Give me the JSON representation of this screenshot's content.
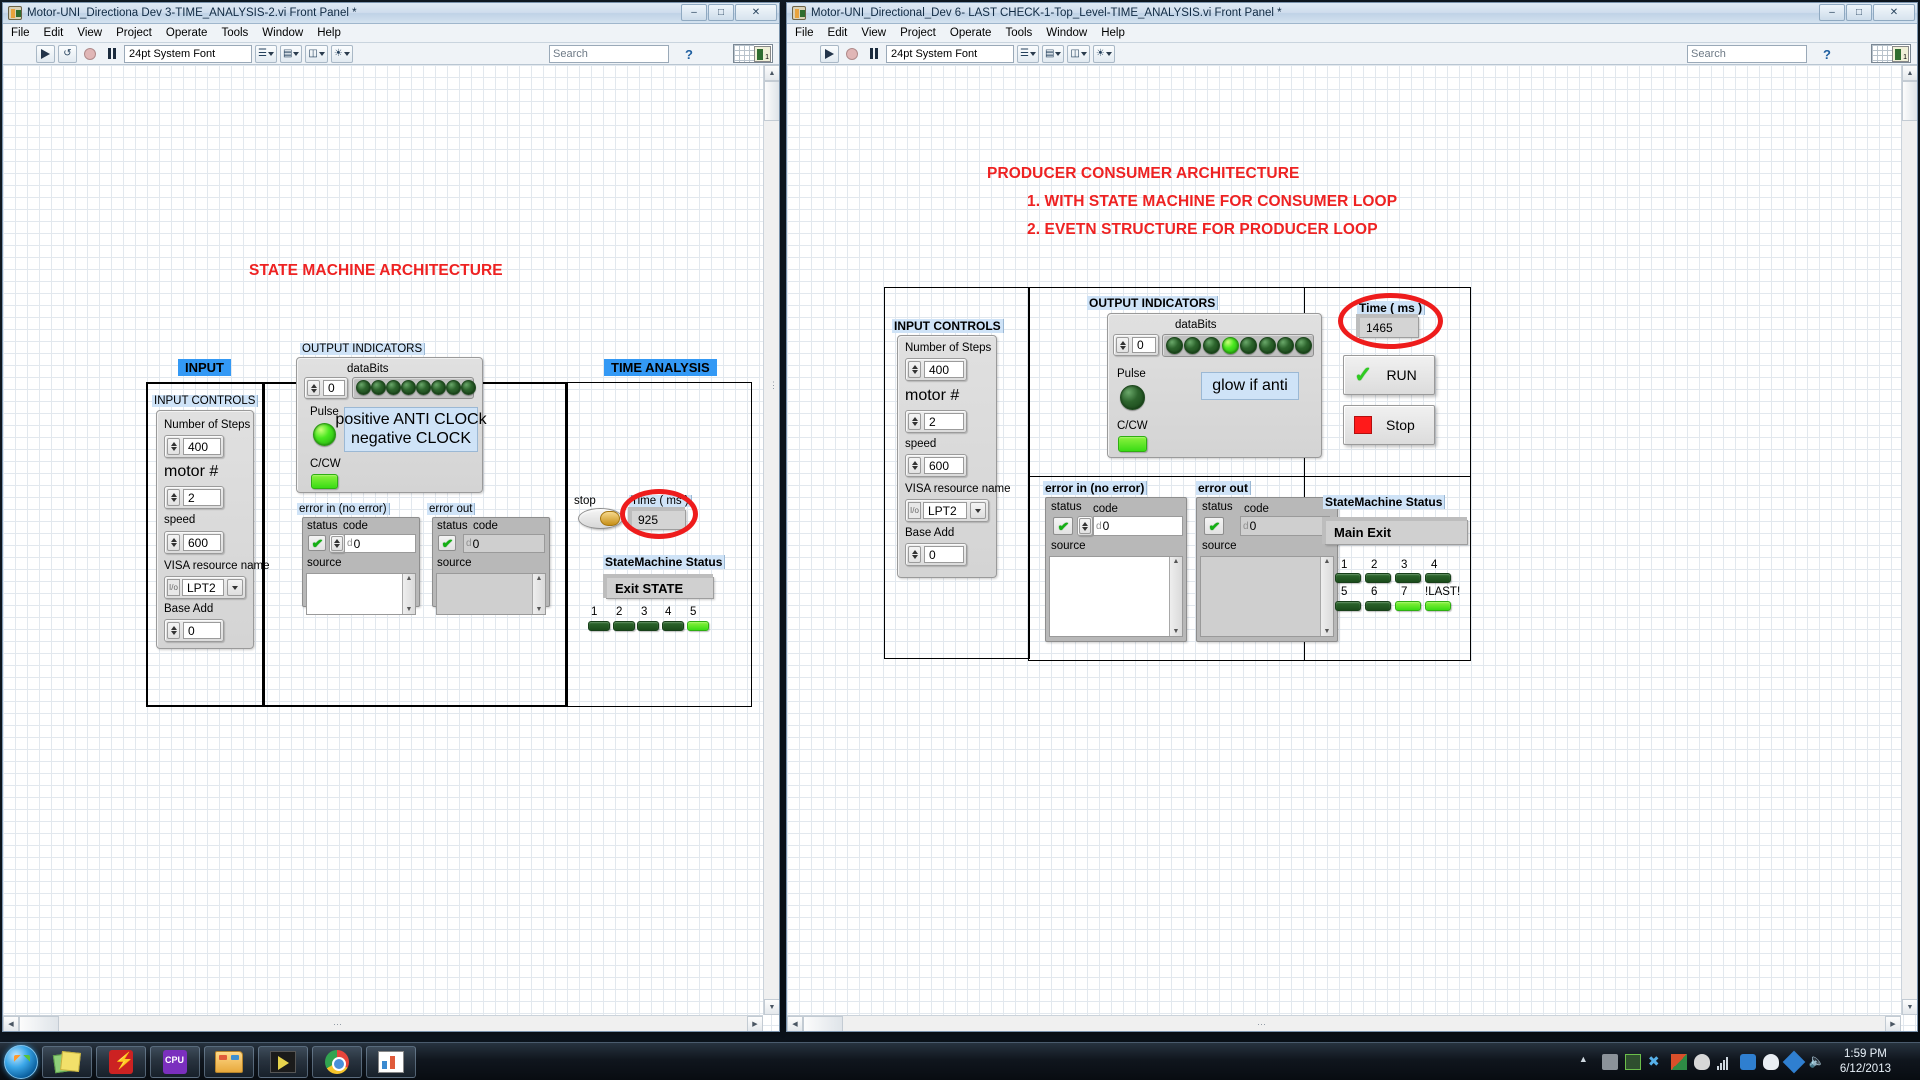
{
  "desktop": {
    "taskbar": {
      "start_label": "Start",
      "items": [
        {
          "name": "sticky-notes",
          "icon": "sticky-notes-icon"
        },
        {
          "name": "security-app",
          "icon": "shield-lightning-icon"
        },
        {
          "name": "cpu-monitor",
          "icon": "cpu-icon"
        },
        {
          "name": "windows-explorer",
          "icon": "folder-icon"
        },
        {
          "name": "labview",
          "icon": "labview-icon"
        },
        {
          "name": "google-chrome",
          "icon": "chrome-icon"
        },
        {
          "name": "labview-project",
          "icon": "labview-vi-icon"
        }
      ],
      "tray_icons": [
        "show-hidden-icons-arrow",
        "usb-safely-remove-icon",
        "network-activity-icon",
        "xmarks-icon",
        "winrar-icon",
        "volume-mixer-icon",
        "signal-bars-icon",
        "teamviewer-icon",
        "skydrive-icon",
        "dropbox-icon",
        "speaker-icon"
      ],
      "clock_time": "1:59 PM",
      "clock_date": "6/12/2013"
    }
  },
  "colors": {
    "accent_blue": "#3399f5",
    "label_highlight": "#cfe3f7",
    "annotation_red": "#ee1c1c",
    "led_on": "#39dc14",
    "led_off": "#2d642d"
  },
  "menu": {
    "items": [
      "File",
      "Edit",
      "View",
      "Project",
      "Operate",
      "Tools",
      "Window",
      "Help"
    ]
  },
  "toolbar": {
    "font_selector": "24pt System Font",
    "search_placeholder": "Search",
    "buttons": [
      "run",
      "run-continuously",
      "abort-execution",
      "pause",
      "align-objects",
      "distribute-objects",
      "resize-objects",
      "reorder"
    ]
  },
  "window_left": {
    "title": "Motor-UNI_Directiona Dev 3-TIME_ANALYSIS-2.vi Front Panel *",
    "heading": "STATE MACHINE ARCHITECTURE",
    "tabs": {
      "input": "INPUT",
      "output": "OUTPUT",
      "time": "TIME ANALYSIS"
    },
    "input_controls": {
      "group_label": "INPUT CONTROLS",
      "fields": [
        {
          "label": "Number of Steps",
          "value": "400"
        },
        {
          "label": "motor #",
          "value": "2"
        },
        {
          "label": "speed",
          "value": "600"
        },
        {
          "label": "VISA resource name",
          "value": "LPT2"
        },
        {
          "label": "Base Add",
          "value": "0"
        }
      ]
    },
    "output_indicators": {
      "group_label": "OUTPUT INDICATORS",
      "databits_label": "dataBits",
      "databits_index": "0",
      "databits_leds": [
        false,
        false,
        false,
        false,
        false,
        false,
        false,
        false
      ],
      "pulse_label": "Pulse",
      "pulse_on": true,
      "ccw_label": "C/CW",
      "ccw_on": true,
      "callout": "positive ANTI CLOCk\nnegative CLOCK"
    },
    "error_in": {
      "title": "error in (no error)",
      "status_label": "status",
      "code_label": "code",
      "code_value": "0",
      "source_label": "source",
      "source_value": ""
    },
    "error_out": {
      "title": "error out",
      "status_label": "status",
      "code_label": "code",
      "code_value": "0",
      "source_label": "source",
      "source_value": ""
    },
    "time_analysis": {
      "stop_label": "stop",
      "time_label": "Time ( ms )",
      "time_value": "925",
      "statemachine_label": "StateMachine Status",
      "state_value": "Exit STATE",
      "led_labels": [
        "1",
        "2",
        "3",
        "4",
        "5"
      ],
      "leds": [
        false,
        false,
        false,
        false,
        true
      ]
    }
  },
  "window_right": {
    "title": "Motor-UNI_Directional_Dev 6- LAST CHECK-1-Top_Level-TIME_ANALYSIS.vi Front Panel *",
    "heading_lines": [
      "PRODUCER CONSUMER ARCHITECTURE",
      "1. WITH STATE MACHINE FOR CONSUMER LOOP",
      "2. EVETN STRUCTURE FOR PRODUCER LOOP"
    ],
    "input_controls": {
      "group_label": "INPUT CONTROLS",
      "fields": [
        {
          "label": "Number of Steps",
          "value": "400"
        },
        {
          "label": "motor #",
          "value": "2"
        },
        {
          "label": "speed",
          "value": "600"
        },
        {
          "label": "VISA resource name",
          "value": "LPT2"
        },
        {
          "label": "Base Add",
          "value": "0"
        }
      ]
    },
    "output_indicators": {
      "group_label": "OUTPUT INDICATORS",
      "databits_label": "dataBits",
      "databits_index": "0",
      "databits_leds": [
        false,
        false,
        false,
        true,
        false,
        false,
        false,
        false
      ],
      "pulse_label": "Pulse",
      "pulse_on": false,
      "ccw_label": "C/CW",
      "ccw_on": true,
      "callout": "glow if anti"
    },
    "error_in": {
      "title": "error in (no error)",
      "status_label": "status",
      "code_label": "code",
      "code_value": "0",
      "source_label": "source",
      "source_value": ""
    },
    "error_out": {
      "title": "error out",
      "status_label": "status",
      "code_label": "code",
      "code_value": "0",
      "source_label": "source",
      "source_value": ""
    },
    "run_panel": {
      "time_label": "Time ( ms )",
      "time_value": "1465",
      "run_label": "RUN",
      "stop_label": "Stop"
    },
    "statemachine": {
      "title": "StateMachine Status",
      "state_value": "Main Exit",
      "led_labels_row1": [
        "1",
        "2",
        "3",
        "4"
      ],
      "led_labels_row2": [
        "5",
        "6",
        "7",
        "!LAST!"
      ],
      "leds_row1": [
        false,
        false,
        false,
        false
      ],
      "leds_row2": [
        false,
        false,
        true,
        true
      ]
    }
  }
}
